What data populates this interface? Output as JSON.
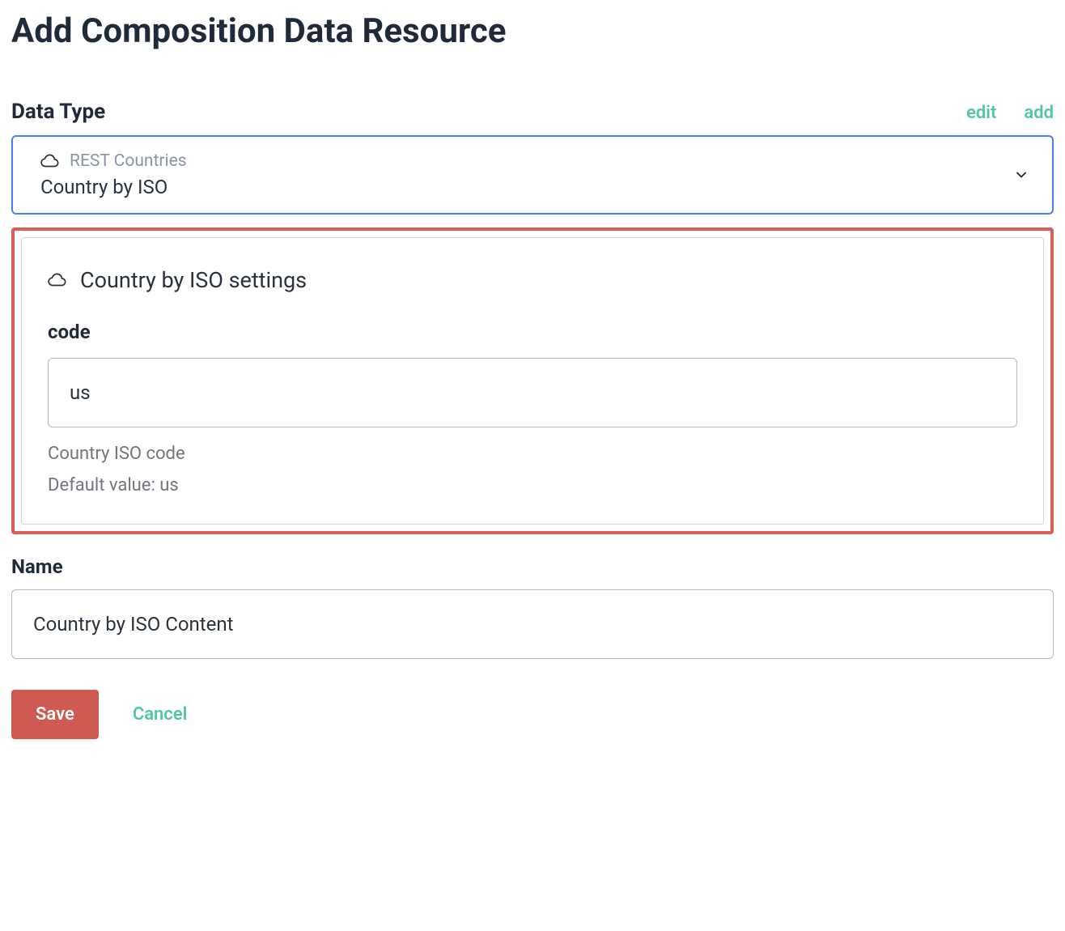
{
  "page": {
    "title": "Add Composition Data Resource"
  },
  "dataType": {
    "label": "Data Type",
    "editLabel": "edit",
    "addLabel": "add",
    "source": "REST Countries",
    "value": "Country by ISO"
  },
  "settings": {
    "title": "Country by ISO settings",
    "fields": {
      "code": {
        "label": "code",
        "value": "us",
        "help1": "Country ISO code",
        "help2": "Default value: us"
      }
    }
  },
  "name": {
    "label": "Name",
    "value": "Country by ISO Content"
  },
  "buttons": {
    "save": "Save",
    "cancel": "Cancel"
  }
}
